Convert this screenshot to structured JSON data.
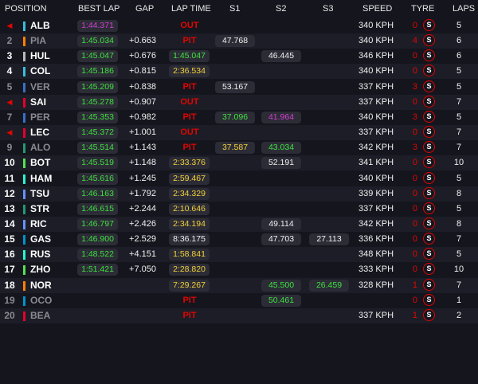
{
  "headers": {
    "position": "POSITION",
    "best_lap": "BEST LAP",
    "gap": "GAP",
    "lap_time": "LAP TIME",
    "s1": "S1",
    "s2": "S2",
    "s3": "S3",
    "speed": "SPEED",
    "tyre": "TYRE",
    "laps": "LAPS"
  },
  "tyre_compound": "S",
  "colors": {
    "personal_best": "#3ee03e",
    "overall_best": "#d13ed1",
    "current_lap": "#f2d13a",
    "alert": "#e10600"
  },
  "rows": [
    {
      "pos": "",
      "out_marker": true,
      "driver": "ALB",
      "team_color": "#37bedd",
      "best_lap": "1:44.371",
      "best_lap_color": "purple",
      "gap": "",
      "lap_time": "",
      "status": "OUT",
      "s1": "",
      "s1_color": "",
      "s2": "",
      "s2_color": "",
      "s3": "",
      "s3_color": "",
      "speed": "340 KPH",
      "tyre_age": "0",
      "laps": "5",
      "dim": false
    },
    {
      "pos": "2",
      "out_marker": false,
      "driver": "PIA",
      "team_color": "#ff8000",
      "best_lap": "1:45.034",
      "best_lap_color": "green",
      "gap": "+0.663",
      "lap_time": "",
      "status": "PIT",
      "s1": "47.768",
      "s1_color": "white",
      "s2": "",
      "s2_color": "",
      "s3": "",
      "s3_color": "",
      "speed": "340 KPH",
      "tyre_age": "4",
      "laps": "6",
      "dim": true
    },
    {
      "pos": "3",
      "out_marker": false,
      "driver": "HUL",
      "team_color": "#b6babd",
      "best_lap": "1:45.047",
      "best_lap_color": "green",
      "gap": "+0.676",
      "lap_time": "1:45.047",
      "lap_time_color": "green",
      "status": "",
      "s1": "",
      "s1_color": "",
      "s2": "46.445",
      "s2_color": "white",
      "s3": "",
      "s3_color": "",
      "speed": "346 KPH",
      "tyre_age": "0",
      "laps": "6",
      "dim": false
    },
    {
      "pos": "4",
      "out_marker": false,
      "driver": "COL",
      "team_color": "#37bedd",
      "best_lap": "1:45.186",
      "best_lap_color": "green",
      "gap": "+0.815",
      "lap_time": "2:36.534",
      "lap_time_color": "yellow",
      "status": "",
      "s1": "",
      "s1_color": "",
      "s2": "",
      "s2_color": "",
      "s3": "",
      "s3_color": "",
      "speed": "340 KPH",
      "tyre_age": "0",
      "laps": "5",
      "dim": false
    },
    {
      "pos": "5",
      "out_marker": false,
      "driver": "VER",
      "team_color": "#3671c6",
      "best_lap": "1:45.209",
      "best_lap_color": "green",
      "gap": "+0.838",
      "lap_time": "",
      "status": "PIT",
      "s1": "53.167",
      "s1_color": "white",
      "s2": "",
      "s2_color": "",
      "s3": "",
      "s3_color": "",
      "speed": "337 KPH",
      "tyre_age": "3",
      "laps": "5",
      "dim": true
    },
    {
      "pos": "",
      "out_marker": true,
      "driver": "SAI",
      "team_color": "#e8002d",
      "best_lap": "1:45.278",
      "best_lap_color": "green",
      "gap": "+0.907",
      "lap_time": "",
      "status": "OUT",
      "s1": "",
      "s1_color": "",
      "s2": "",
      "s2_color": "",
      "s3": "",
      "s3_color": "",
      "speed": "337 KPH",
      "tyre_age": "0",
      "laps": "7",
      "dim": false
    },
    {
      "pos": "7",
      "out_marker": false,
      "driver": "PER",
      "team_color": "#3671c6",
      "best_lap": "1:45.353",
      "best_lap_color": "green",
      "gap": "+0.982",
      "lap_time": "",
      "status": "PIT",
      "s1": "37.096",
      "s1_color": "green",
      "s2": "41.964",
      "s2_color": "purple",
      "s3": "",
      "s3_color": "",
      "speed": "340 KPH",
      "tyre_age": "3",
      "laps": "5",
      "dim": true
    },
    {
      "pos": "",
      "out_marker": true,
      "driver": "LEC",
      "team_color": "#e8002d",
      "best_lap": "1:45.372",
      "best_lap_color": "green",
      "gap": "+1.001",
      "lap_time": "",
      "status": "OUT",
      "s1": "",
      "s1_color": "",
      "s2": "",
      "s2_color": "",
      "s3": "",
      "s3_color": "",
      "speed": "337 KPH",
      "tyre_age": "0",
      "laps": "7",
      "dim": false
    },
    {
      "pos": "9",
      "out_marker": false,
      "driver": "ALO",
      "team_color": "#229971",
      "best_lap": "1:45.514",
      "best_lap_color": "green",
      "gap": "+1.143",
      "lap_time": "",
      "status": "PIT",
      "s1": "37.587",
      "s1_color": "yellow",
      "s2": "43.034",
      "s2_color": "green",
      "s3": "",
      "s3_color": "",
      "speed": "342 KPH",
      "tyre_age": "3",
      "laps": "7",
      "dim": true
    },
    {
      "pos": "10",
      "out_marker": false,
      "driver": "BOT",
      "team_color": "#52e252",
      "best_lap": "1:45.519",
      "best_lap_color": "green",
      "gap": "+1.148",
      "lap_time": "2:33.376",
      "lap_time_color": "yellow",
      "status": "",
      "s1": "",
      "s1_color": "",
      "s2": "52.191",
      "s2_color": "white",
      "s3": "",
      "s3_color": "",
      "speed": "341 KPH",
      "tyre_age": "0",
      "laps": "10",
      "dim": false
    },
    {
      "pos": "11",
      "out_marker": false,
      "driver": "HAM",
      "team_color": "#27f4d2",
      "best_lap": "1:45.616",
      "best_lap_color": "green",
      "gap": "+1.245",
      "lap_time": "2:59.467",
      "lap_time_color": "yellow",
      "status": "",
      "s1": "",
      "s1_color": "",
      "s2": "",
      "s2_color": "",
      "s3": "",
      "s3_color": "",
      "speed": "340 KPH",
      "tyre_age": "0",
      "laps": "5",
      "dim": false
    },
    {
      "pos": "12",
      "out_marker": false,
      "driver": "TSU",
      "team_color": "#6692ff",
      "best_lap": "1:46.163",
      "best_lap_color": "green",
      "gap": "+1.792",
      "lap_time": "2:34.329",
      "lap_time_color": "yellow",
      "status": "",
      "s1": "",
      "s1_color": "",
      "s2": "",
      "s2_color": "",
      "s3": "",
      "s3_color": "",
      "speed": "339 KPH",
      "tyre_age": "0",
      "laps": "8",
      "dim": false
    },
    {
      "pos": "13",
      "out_marker": false,
      "driver": "STR",
      "team_color": "#229971",
      "best_lap": "1:46.615",
      "best_lap_color": "green",
      "gap": "+2.244",
      "lap_time": "2:10.646",
      "lap_time_color": "yellow",
      "status": "",
      "s1": "",
      "s1_color": "",
      "s2": "",
      "s2_color": "",
      "s3": "",
      "s3_color": "",
      "speed": "337 KPH",
      "tyre_age": "0",
      "laps": "5",
      "dim": false
    },
    {
      "pos": "14",
      "out_marker": false,
      "driver": "RIC",
      "team_color": "#6692ff",
      "best_lap": "1:46.797",
      "best_lap_color": "green",
      "gap": "+2.426",
      "lap_time": "2:34.194",
      "lap_time_color": "yellow",
      "status": "",
      "s1": "",
      "s1_color": "",
      "s2": "49.114",
      "s2_color": "white",
      "s3": "",
      "s3_color": "",
      "speed": "342 KPH",
      "tyre_age": "0",
      "laps": "8",
      "dim": false
    },
    {
      "pos": "15",
      "out_marker": false,
      "driver": "GAS",
      "team_color": "#0093cc",
      "best_lap": "1:46.900",
      "best_lap_color": "green",
      "gap": "+2.529",
      "lap_time": "8:36.175",
      "lap_time_color": "white",
      "status": "",
      "s1": "",
      "s1_color": "",
      "s2": "47.703",
      "s2_color": "white",
      "s3": "27.113",
      "s3_color": "white",
      "speed": "336 KPH",
      "tyre_age": "0",
      "laps": "7",
      "dim": false
    },
    {
      "pos": "16",
      "out_marker": false,
      "driver": "RUS",
      "team_color": "#27f4d2",
      "best_lap": "1:48.522",
      "best_lap_color": "green",
      "gap": "+4.151",
      "lap_time": "1:58.841",
      "lap_time_color": "yellow",
      "status": "",
      "s1": "",
      "s1_color": "",
      "s2": "",
      "s2_color": "",
      "s3": "",
      "s3_color": "",
      "speed": "348 KPH",
      "tyre_age": "0",
      "laps": "5",
      "dim": false
    },
    {
      "pos": "17",
      "out_marker": false,
      "driver": "ZHO",
      "team_color": "#52e252",
      "best_lap": "1:51.421",
      "best_lap_color": "green",
      "gap": "+7.050",
      "lap_time": "2:28.820",
      "lap_time_color": "yellow",
      "status": "",
      "s1": "",
      "s1_color": "",
      "s2": "",
      "s2_color": "",
      "s3": "",
      "s3_color": "",
      "speed": "333 KPH",
      "tyre_age": "0",
      "laps": "10",
      "dim": false
    },
    {
      "pos": "18",
      "out_marker": false,
      "driver": "NOR",
      "team_color": "#ff8000",
      "best_lap": "",
      "best_lap_color": "",
      "gap": "",
      "lap_time": "7:29.267",
      "lap_time_color": "yellow",
      "status": "",
      "s1": "",
      "s1_color": "",
      "s2": "45.500",
      "s2_color": "green",
      "s3": "26.459",
      "s3_color": "green",
      "speed": "328 KPH",
      "tyre_age": "1",
      "laps": "7",
      "dim": false
    },
    {
      "pos": "19",
      "out_marker": false,
      "driver": "OCO",
      "team_color": "#0093cc",
      "best_lap": "",
      "best_lap_color": "",
      "gap": "",
      "lap_time": "",
      "status": "PIT",
      "s1": "",
      "s1_color": "",
      "s2": "50.461",
      "s2_color": "green",
      "s3": "",
      "s3_color": "",
      "speed": "",
      "tyre_age": "0",
      "laps": "1",
      "dim": true
    },
    {
      "pos": "20",
      "out_marker": false,
      "driver": "BEA",
      "team_color": "#e8002d",
      "best_lap": "",
      "best_lap_color": "",
      "gap": "",
      "lap_time": "",
      "status": "PIT",
      "s1": "",
      "s1_color": "",
      "s2": "",
      "s2_color": "",
      "s3": "",
      "s3_color": "",
      "speed": "337 KPH",
      "tyre_age": "1",
      "laps": "2",
      "dim": true
    }
  ]
}
